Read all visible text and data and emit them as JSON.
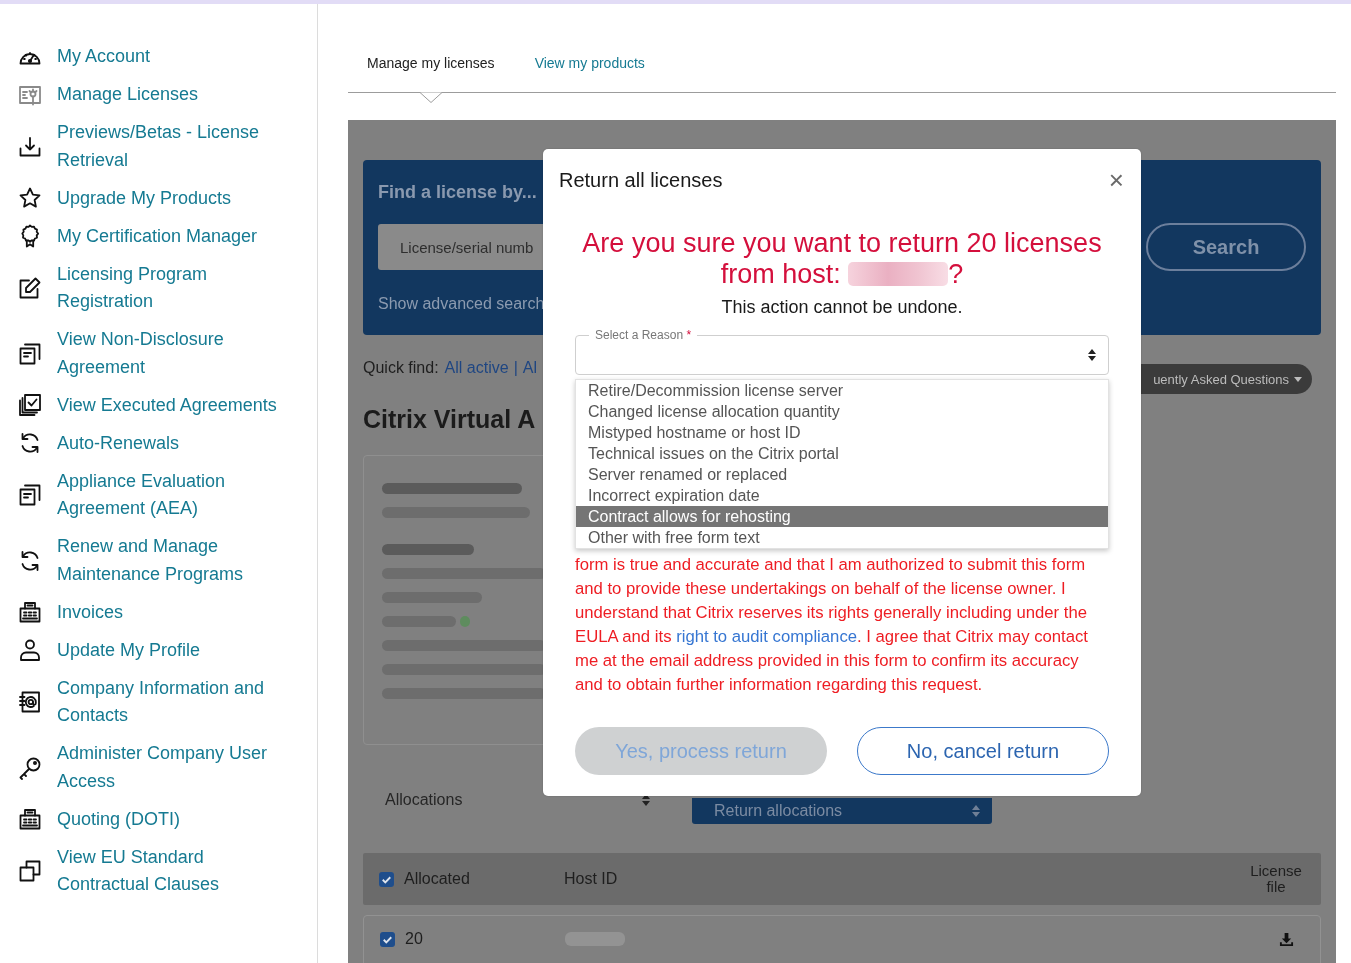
{
  "sidebar": {
    "items": [
      {
        "label": "My Account"
      },
      {
        "label": "Manage Licenses"
      },
      {
        "label": "Previews/Betas - License Retrieval"
      },
      {
        "label": "Upgrade My Products"
      },
      {
        "label": "My Certification Manager"
      },
      {
        "label": "Licensing Program Registration"
      },
      {
        "label": "View Non-Disclosure Agreement"
      },
      {
        "label": "View Executed Agreements"
      },
      {
        "label": "Auto-Renewals"
      },
      {
        "label": "Appliance Evaluation Agreement (AEA)"
      },
      {
        "label": "Renew and Manage Maintenance Programs"
      },
      {
        "label": "Invoices"
      },
      {
        "label": "Update My Profile"
      },
      {
        "label": "Company Information and Contacts"
      },
      {
        "label": "Administer Company User Access"
      },
      {
        "label": "Quoting (DOTI)"
      },
      {
        "label": "View EU Standard Contractual Clauses"
      }
    ]
  },
  "tabs": [
    {
      "label": "Manage my licenses",
      "selected": true
    },
    {
      "label": "View my products",
      "selected": false
    }
  ],
  "search_panel": {
    "title": "Find a license by...",
    "field": {
      "placeholder": "License/serial numb"
    },
    "search_button": "Search",
    "advanced_link": "Show advanced search"
  },
  "quick_find": {
    "label": "Quick find:",
    "links": [
      "All active",
      "Al"
    ],
    "separator": "|",
    "faq_button": "uently Asked Questions"
  },
  "product_title": "Citrix Virtual A",
  "allocations_select": {
    "value": "Allocations"
  },
  "return_select": {
    "value": "Return allocations"
  },
  "table": {
    "columns": [
      "Allocated",
      "Host ID",
      "License file"
    ],
    "header_checked": true,
    "rows": [
      {
        "checked": true,
        "allocated": "20"
      }
    ]
  },
  "modal": {
    "title": "Return all licenses",
    "close": "×",
    "question": "Are you sure you want to return 20 licenses from host:",
    "question_end": "?",
    "warning": "This action cannot be undone.",
    "reason_select": {
      "label": "Select a Reason",
      "required_mark": "*",
      "options": [
        {
          "label": "Retire/Decommission license server",
          "selected": false
        },
        {
          "label": "Changed license allocation quantity",
          "selected": false
        },
        {
          "label": "Mistyped hostname or host ID",
          "selected": false
        },
        {
          "label": "Technical issues on the Citrix portal",
          "selected": false
        },
        {
          "label": "Server renamed or replaced",
          "selected": false
        },
        {
          "label": "Incorrect expiration date",
          "selected": false
        },
        {
          "label": "Contract allows for rehosting",
          "selected": true
        },
        {
          "label": "Other with free form text",
          "selected": false
        }
      ]
    },
    "consent": {
      "text_before": "form is true and accurate and that I am authorized to submit this form and to provide these undertakings on behalf of the license owner. I understand that Citrix reserves its rights generally including under the EULA and its ",
      "link": "right to audit compliance",
      "text_after": ". I agree that Citrix may contact me at the email address provided in this form to confirm its accuracy and to obtain further information regarding this request."
    },
    "buttons": [
      {
        "label": "Yes, process return",
        "kind": "primary",
        "disabled": true
      },
      {
        "label": "No, cancel return",
        "kind": "secondary",
        "disabled": false
      }
    ]
  }
}
